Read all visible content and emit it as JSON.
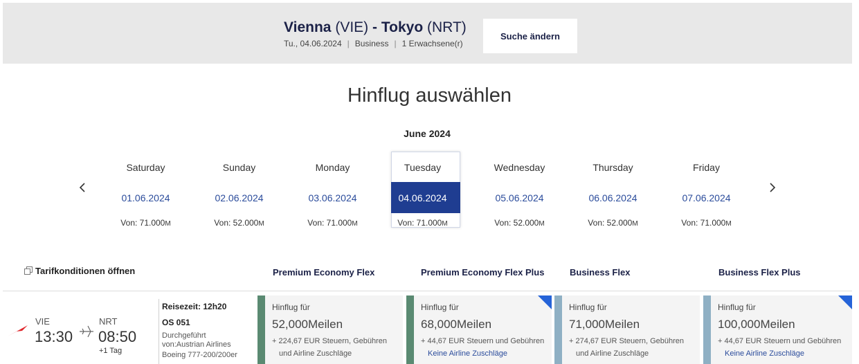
{
  "header": {
    "origin_city": "Vienna",
    "origin_code": "(VIE)",
    "dash": "-",
    "dest_city": "Tokyo",
    "dest_code": "(NRT)",
    "date": "Tu., 04.06.2024",
    "cabin": "Business",
    "passengers": "1 Erwachsene(r)",
    "separator": "|",
    "change_label": "Suche ändern"
  },
  "title": "Hinflug auswählen",
  "calendar": {
    "month": "June 2024",
    "days": [
      {
        "name": "Saturday",
        "date": "01.06.2024",
        "price": "Von: 71.000",
        "unit": "M"
      },
      {
        "name": "Sunday",
        "date": "02.06.2024",
        "price": "Von: 52.000",
        "unit": "M"
      },
      {
        "name": "Monday",
        "date": "03.06.2024",
        "price": "Von: 71.000",
        "unit": "M"
      },
      {
        "name": "Tuesday",
        "date": "04.06.2024",
        "price": "Von: 71.000",
        "unit": "M"
      },
      {
        "name": "Wednesday",
        "date": "05.06.2024",
        "price": "Von: 52.000",
        "unit": "M"
      },
      {
        "name": "Thursday",
        "date": "06.06.2024",
        "price": "Von: 52.000",
        "unit": "M"
      },
      {
        "name": "Friday",
        "date": "07.06.2024",
        "price": "Von: 71.000",
        "unit": "M"
      }
    ],
    "selected_index": 3
  },
  "fare_conditions": "Tarifkonditionen öffnen",
  "fare_columns": [
    "Premium Economy Flex",
    "Premium Economy Flex Plus",
    "Business Flex",
    "Business Flex Plus"
  ],
  "flight": {
    "dep_code": "VIE",
    "dep_time": "13:30",
    "arr_code": "NRT",
    "arr_time": "08:50",
    "plus_day": "+1 Tag",
    "duration": "Reisezeit: 12h20",
    "number": "OS 051",
    "operated": "Durchgeführt",
    "operator": "von:Austrian Airlines",
    "aircraft": "Boeing 777-200/200er"
  },
  "fares": [
    {
      "label": "Hinflug für",
      "miles": "52,000Meilen",
      "tax1": "+ 224,67 EUR Steuern, Gebühren",
      "tax2": "und Airline Zuschläge",
      "color": "#5a8a72",
      "link": false,
      "corner": false
    },
    {
      "label": "Hinflug für",
      "miles": "68,000Meilen",
      "tax1": "+ 44,67 EUR Steuern und Gebühren",
      "tax2": "Keine Airline Zuschläge",
      "color": "#5a8a72",
      "link": true,
      "corner": true
    },
    {
      "label": "Hinflug für",
      "miles": "71,000Meilen",
      "tax1": "+ 274,67 EUR Steuern, Gebühren",
      "tax2": "und Airline Zuschläge",
      "color": "#8fb0c4",
      "link": false,
      "corner": false
    },
    {
      "label": "Hinflug für",
      "miles": "100,000Meilen",
      "tax1": "+ 44,67 EUR Steuern und Gebühren",
      "tax2": "Keine Airline Zuschläge",
      "color": "#8fb0c4",
      "link": true,
      "corner": true
    }
  ]
}
